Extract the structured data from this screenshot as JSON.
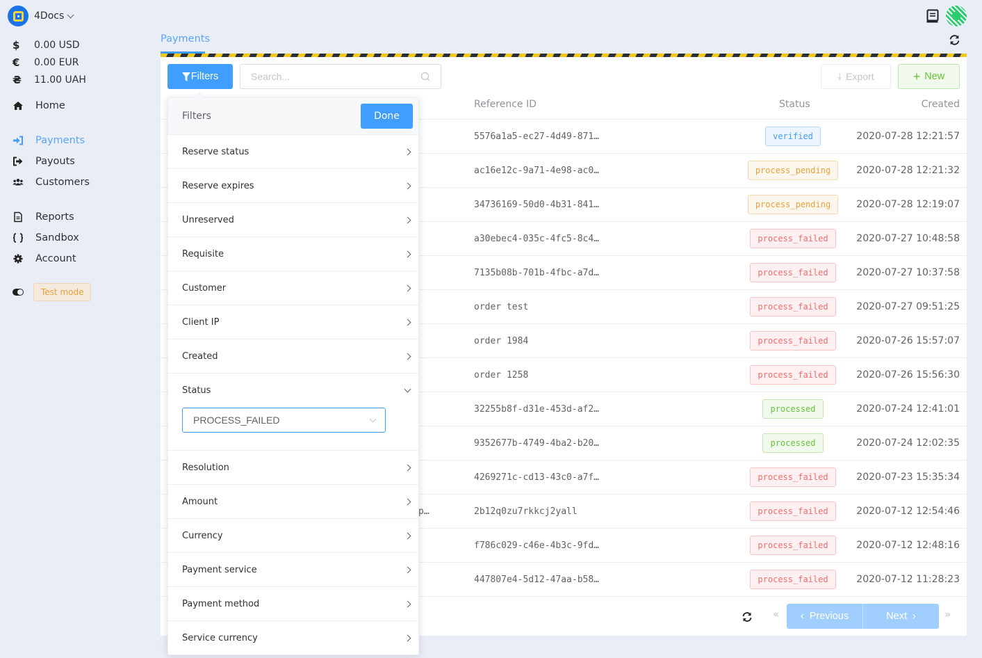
{
  "app": {
    "name": "4Docs"
  },
  "balances": [
    {
      "symbol": "$",
      "label": "0.00 USD"
    },
    {
      "symbol": "€",
      "label": "0.00 EUR"
    },
    {
      "symbol": "₴",
      "label": "11.00 UAH"
    }
  ],
  "nav": {
    "home": "Home",
    "payments": "Payments",
    "payouts": "Payouts",
    "customers": "Customers",
    "reports": "Reports",
    "sandbox": "Sandbox",
    "account": "Account",
    "test_mode": "Test mode"
  },
  "header": {
    "breadcrumb": "Payments"
  },
  "toolbar": {
    "filters_label": "Filters",
    "search_placeholder": "Search...",
    "export_label": "Export",
    "new_label": "New"
  },
  "table": {
    "columns": {
      "reference_id": "Reference ID",
      "status": "Status",
      "created": "Created"
    },
    "rows": [
      {
        "left": "",
        "ref": "5576a1a5-ec27-4d49-871…",
        "status": "verified",
        "created": "2020-07-28 12:21:57"
      },
      {
        "left": "",
        "ref": "ac16e12c-9a71-4e98-ac0…",
        "status": "process_pending",
        "created": "2020-07-28 12:21:32"
      },
      {
        "left": "",
        "ref": "34736169-50d0-4b31-841…",
        "status": "process_pending",
        "created": "2020-07-28 12:19:07"
      },
      {
        "left": "",
        "ref": "a30ebec4-035c-4fc5-8c4…",
        "status": "process_failed",
        "created": "2020-07-27 10:48:58"
      },
      {
        "left": "",
        "ref": "7135b08b-701b-4fbc-a7d…",
        "status": "process_failed",
        "created": "2020-07-27 10:37:58"
      },
      {
        "left": "",
        "ref": "order test",
        "status": "process_failed",
        "created": "2020-07-27 09:51:25"
      },
      {
        "left": "",
        "ref": "order 1984",
        "status": "process_failed",
        "created": "2020-07-26 15:57:07"
      },
      {
        "left": "",
        "ref": "order 1258",
        "status": "process_failed",
        "created": "2020-07-26 15:56:30"
      },
      {
        "left": "",
        "ref": "32255b8f-d31e-453d-af2…",
        "status": "processed",
        "created": "2020-07-24 12:41:01"
      },
      {
        "left": "",
        "ref": "9352677b-4749-4ba2-b20…",
        "status": "processed",
        "created": "2020-07-24 12:02:35"
      },
      {
        "left": "",
        "ref": "4269271c-cd13-43c0-a7f…",
        "status": "process_failed",
        "created": "2020-07-23 15:35:34"
      },
      {
        "left": "p…",
        "ref": "2b12q0zu7rkkcj2yall",
        "status": "process_failed",
        "created": "2020-07-12 12:54:46"
      },
      {
        "left": "",
        "ref": "f786c029-c46e-4b3c-9fd…",
        "status": "process_failed",
        "created": "2020-07-12 12:48:16"
      },
      {
        "left": "",
        "ref": "447807e4-5d12-47aa-b58…",
        "status": "process_failed",
        "created": "2020-07-12 11:28:23"
      }
    ]
  },
  "pagination": {
    "previous": "Previous",
    "next": "Next"
  },
  "filters_panel": {
    "title": "Filters",
    "done_label": "Done",
    "items_before": [
      "Reserve status",
      "Reserve expires",
      "Unreserved",
      "Requisite",
      "Customer",
      "Client IP",
      "Created"
    ],
    "expanded": {
      "label": "Status",
      "selected": "PROCESS_FAILED"
    },
    "items_after": [
      "Resolution",
      "Amount",
      "Currency",
      "Payment service",
      "Payment method",
      "Service currency"
    ]
  },
  "colors": {
    "primary": "#409eff",
    "success": "#67c23a",
    "warning": "#e6a23c",
    "danger": "#f56c6c",
    "active_nav": "#5aa6f5"
  }
}
